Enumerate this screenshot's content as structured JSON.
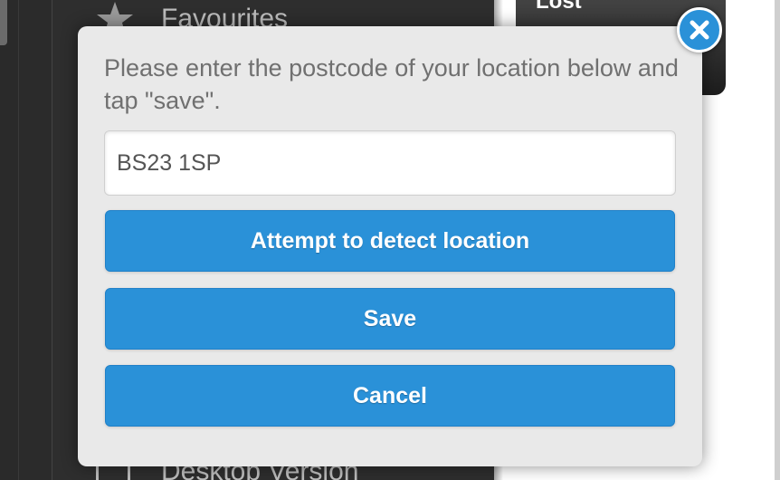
{
  "background": {
    "menu": {
      "favourites_label": "Favourites",
      "favourites_icon": "star-icon",
      "desktop_label": "Desktop Version"
    },
    "card": {
      "title": "Lost"
    }
  },
  "modal": {
    "message": "Please enter the postcode of your location below and tap \"save\".",
    "postcode": {
      "value": "BS23 1SP",
      "placeholder": ""
    },
    "buttons": {
      "detect_label": "Attempt to detect location",
      "save_label": "Save",
      "cancel_label": "Cancel"
    },
    "close_icon": "close-icon"
  },
  "colors": {
    "accent": "#2a91d8",
    "modal_bg": "#e9e9e9",
    "dark_bg": "#2e2e2e",
    "text_muted": "#707070"
  }
}
